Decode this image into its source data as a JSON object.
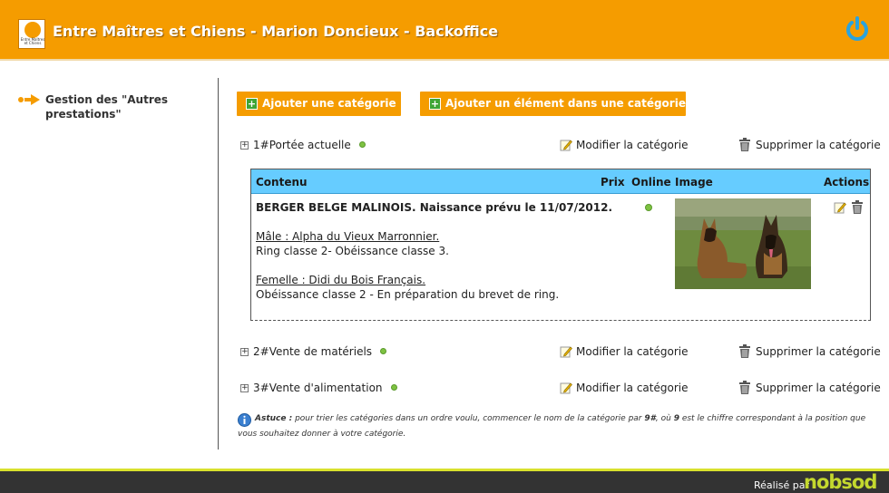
{
  "header": {
    "logo_text": "Entre Maîtres et Chiens",
    "title": "Entre Maîtres et Chiens - Marion Doncieux - Backoffice",
    "power_icon": "power-icon"
  },
  "sidebar": {
    "items": [
      {
        "label": "Gestion des \"Autres prestations\"",
        "icon": "arrow-right-icon"
      }
    ]
  },
  "toolbar": {
    "add_category_label": "Ajouter une catégorie",
    "add_element_label": "Ajouter un élément dans une catégorie"
  },
  "categories": [
    {
      "toggle": "+",
      "name": "1#Portée actuelle",
      "edit_label": "Modifier la catégorie",
      "delete_label": "Supprimer la catégorie",
      "online": true
    },
    {
      "toggle": "+",
      "name": "2#Vente de matériels",
      "edit_label": "Modifier la catégorie",
      "delete_label": "Supprimer la catégorie",
      "online": true
    },
    {
      "toggle": "+",
      "name": "3#Vente d'alimentation",
      "edit_label": "Modifier la catégorie",
      "delete_label": "Supprimer la catégorie",
      "online": true
    }
  ],
  "table": {
    "columns": {
      "content": "Contenu",
      "price": "Prix",
      "online": "Online",
      "image": "Image",
      "actions": "Actions"
    },
    "rows": [
      {
        "title": "BERGER BELGE MALINOIS. Naissance prévu le 11/07/2012.",
        "male_label": "Mâle : Alpha du Vieux Marronnier.",
        "male_desc": "Ring classe 2- Obéissance classe 3.",
        "female_label": "Femelle : Didi du Bois Français.",
        "female_desc": "Obéissance classe 2 - En préparation du brevet de ring.",
        "price": "",
        "online": true
      }
    ]
  },
  "tip": {
    "label": "Astuce :",
    "text_1": " pour trier les catégories dans un ordre voulu, commencer le nom de la catégorie par ",
    "bold_1": "9#",
    "text_2": ", où ",
    "bold_2": "9",
    "text_3": " est le chiffre correspondant à la position que",
    "line_2": "vous souhaitez donner à votre catégorie."
  },
  "footer": {
    "credit": "Réalisé par",
    "brand": "nobsod"
  },
  "colors": {
    "header": "#f59c00",
    "table_header": "#66ccff",
    "online_dot": "#7ec242",
    "footer": "#333333",
    "footer_brand": "#c4d82e"
  }
}
